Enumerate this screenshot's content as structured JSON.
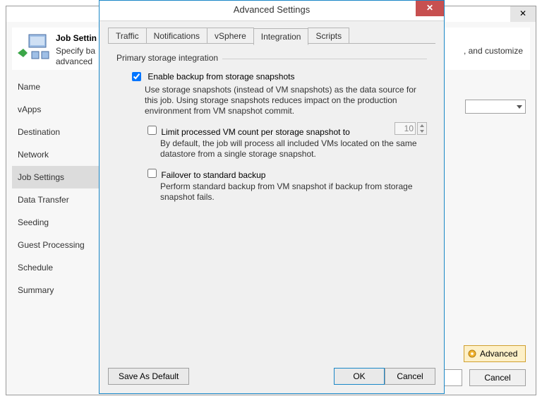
{
  "outer": {
    "title": "Job Settin",
    "subtitle": "Specify ba",
    "subtitle_line2": "advanced",
    "subtitle_right": ", and customize",
    "advanced_btn": "Advanced",
    "cancel_btn": "Cancel"
  },
  "nav": {
    "items": [
      {
        "label": "Name"
      },
      {
        "label": "vApps"
      },
      {
        "label": "Destination"
      },
      {
        "label": "Network"
      },
      {
        "label": "Job Settings"
      },
      {
        "label": "Data Transfer"
      },
      {
        "label": "Seeding"
      },
      {
        "label": "Guest Processing"
      },
      {
        "label": "Schedule"
      },
      {
        "label": "Summary"
      }
    ],
    "selected_index": 4
  },
  "modal": {
    "title": "Advanced Settings",
    "tabs": [
      "Traffic",
      "Notifications",
      "vSphere",
      "Integration",
      "Scripts"
    ],
    "active_tab_index": 3,
    "fieldset_label": "Primary storage integration",
    "enable": {
      "label": "Enable backup from storage snapshots",
      "checked": true,
      "help": "Use storage snapshots (instead of VM snapshots) as the data source for this job. Using storage snapshots reduces impact on the production environment from VM snapshot commit."
    },
    "limit": {
      "label": "Limit processed VM count per storage snapshot to",
      "checked": false,
      "value": "10",
      "help": "By default, the job will process all included VMs located on the same datastore from a single storage snapshot."
    },
    "failover": {
      "label": "Failover to standard backup",
      "checked": false,
      "help": "Perform standard backup from VM snapshot if backup from storage snapshot fails."
    },
    "buttons": {
      "save": "Save As Default",
      "ok": "OK",
      "cancel": "Cancel"
    }
  }
}
